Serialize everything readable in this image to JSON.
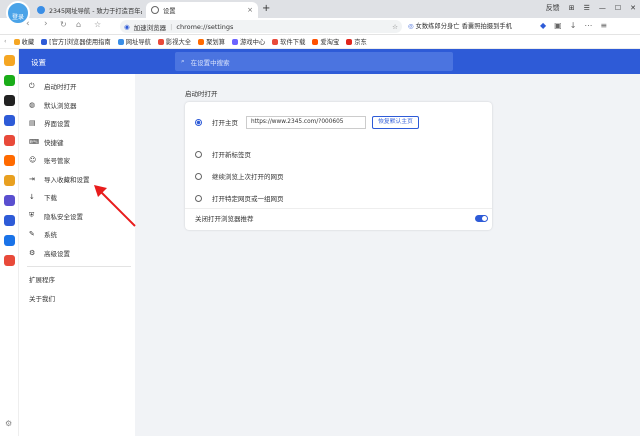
{
  "window": {
    "avatar": "登录",
    "tabs": [
      {
        "title": "2345网址导航 - 致力于打造百年品牌",
        "color": "#3a8ee6"
      },
      {
        "title": "设置",
        "color": "#888888"
      }
    ],
    "account": "反馈"
  },
  "toolbar": {
    "address_site": "加速浏览器",
    "address_url": "chrome://settings",
    "news": "女数练郎分身亡 香囊照拍摄到手机"
  },
  "bookmarks": [
    {
      "label": "收藏",
      "color": "#f5a623"
    },
    {
      "label": "[官方]浏览器使用指南",
      "color": "#2e5bd7"
    },
    {
      "label": "网址导航",
      "color": "#3a8ee6"
    },
    {
      "label": "影视大全",
      "color": "#e84a3a"
    },
    {
      "label": "聚划算",
      "color": "#ff6a00"
    },
    {
      "label": "游戏中心",
      "color": "#6c63ff"
    },
    {
      "label": "软件下载",
      "color": "#e84a3a"
    },
    {
      "label": "爱淘宝",
      "color": "#ff5000"
    },
    {
      "label": "京东",
      "color": "#e1251b"
    }
  ],
  "sideapps": [
    "#f5a623",
    "#1aad19",
    "#222222",
    "#2e5bd7",
    "#e84a3a",
    "#ff6a00",
    "#e8a020",
    "#5a4fcf",
    "#2e5bd7",
    "#1a73e8",
    "#e84a3a"
  ],
  "header": {
    "title": "设置",
    "search_placeholder": "在设置中搜索"
  },
  "nav": [
    {
      "label": "启动时打开",
      "icon": "power-icon"
    },
    {
      "label": "默认浏览器",
      "icon": "globe-icon"
    },
    {
      "label": "界面设置",
      "icon": "layout-icon"
    },
    {
      "label": "快捷键",
      "icon": "keyboard-icon"
    },
    {
      "label": "账号管家",
      "icon": "user-icon"
    },
    {
      "label": "导入收藏和设置",
      "icon": "import-icon"
    },
    {
      "label": "下载",
      "icon": "download-icon"
    },
    {
      "label": "隐私安全设置",
      "icon": "shield-icon"
    },
    {
      "label": "系统",
      "icon": "wrench-icon"
    },
    {
      "label": "高级设置",
      "icon": "gear-icon"
    }
  ],
  "nav_extra": [
    "扩展程序",
    "关于我们"
  ],
  "startup": {
    "section_title": "启动时打开",
    "homepage_label": "打开主页",
    "homepage_url": "https://www.2345.com/?000605",
    "restore_button": "恢复默认主页",
    "options": [
      "打开新标签页",
      "继续浏览上次打开的网页",
      "打开特定网页或一组网页"
    ],
    "recommend_label": "关闭打开浏览器推荐"
  }
}
